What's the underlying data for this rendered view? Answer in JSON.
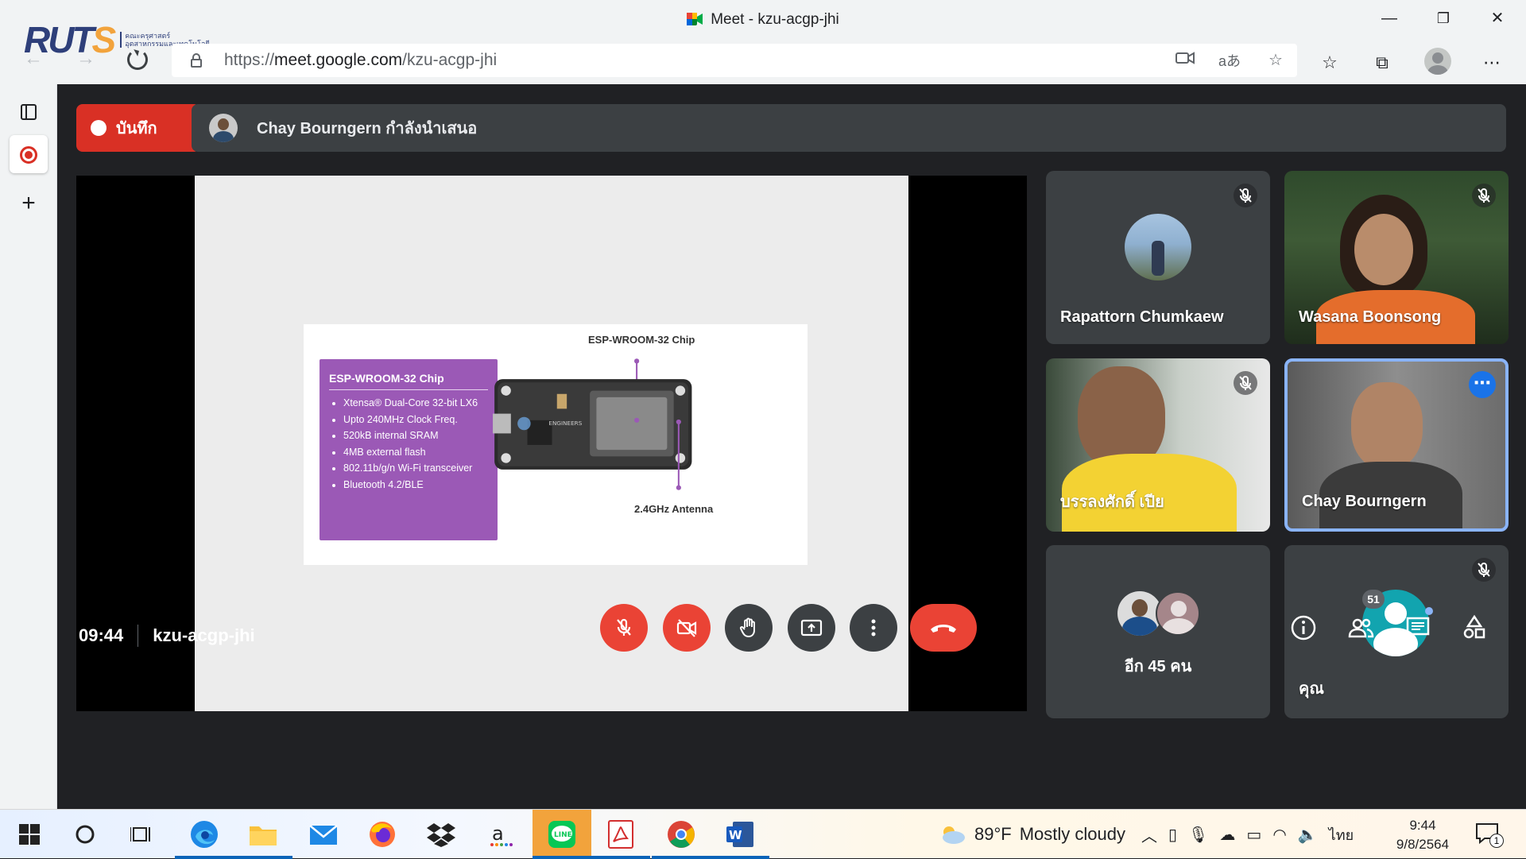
{
  "window": {
    "title": "Meet - kzu-acgp-jhi",
    "minimize": "—",
    "restore": "❐",
    "close": "✕"
  },
  "logo": {
    "text_main": "RUT",
    "text_s": "S",
    "sub_line1": "คณะครุศาสตร์",
    "sub_line2": "อุตสาหกรรมและเทคโนโลยี"
  },
  "address_bar": {
    "url_prefix": "https://",
    "url_host": "meet.google.com",
    "url_path": "/kzu-acgp-jhi"
  },
  "meeting": {
    "recording_label": "บันทึก",
    "presenter_text": "Chay Bourngern กำลังนำเสนอ",
    "time": "09:44",
    "code": "kzu-acgp-jhi",
    "participant_count": "51"
  },
  "slide": {
    "box_title": "ESP-WROOM-32 Chip",
    "bullets": [
      "Xtensa® Dual-Core 32-bit LX6",
      "Upto 240MHz Clock Freq.",
      "520kB internal SRAM",
      "4MB external flash",
      "802.11b/g/n Wi-Fi transceiver",
      "Bluetooth 4.2/BLE"
    ],
    "chip_label": "ESP-WROOM-32 Chip",
    "antenna_label": "2.4GHz Antenna"
  },
  "participants": [
    {
      "name": "Rapattorn Chumkaew",
      "muted": true
    },
    {
      "name": "Wasana Boonsong",
      "muted": true
    },
    {
      "name": "บรรลงศักดิ์ เปีย",
      "muted": true
    },
    {
      "name": "Chay Bourngern",
      "muted": false
    },
    {
      "name": "อีก 45 คน",
      "muted": false
    },
    {
      "name": "คุณ",
      "muted": true
    }
  ],
  "taskbar": {
    "weather_temp": "89°F",
    "weather_desc": "Mostly cloudy",
    "language": "ไทย",
    "clock_time": "9:44",
    "clock_date": "9/8/2564",
    "notification_count": "1"
  },
  "colors": {
    "meet_bg": "#202124",
    "tile_bg": "#3c4043",
    "red": "#ea4335",
    "active_border": "#8ab4f8",
    "slide_purple": "#9b59b6"
  }
}
